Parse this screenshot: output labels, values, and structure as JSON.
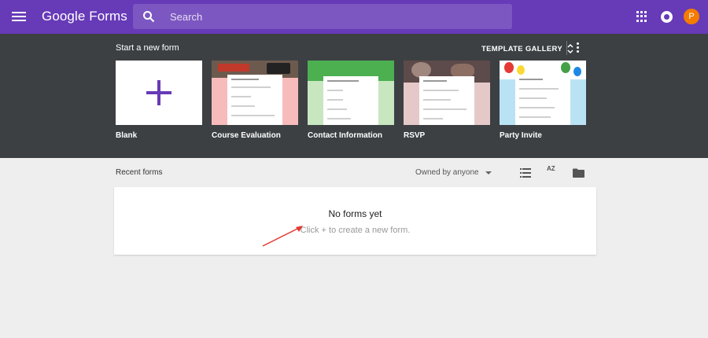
{
  "appbar": {
    "brand": "Google Forms",
    "search_placeholder": "Search",
    "avatar_initial": "P",
    "color": "#673ab7",
    "icons": [
      "menu-icon",
      "search-icon",
      "apps-icon",
      "notifications-icon"
    ]
  },
  "templates": {
    "section_title": "Start a new form",
    "gallery_label": "TEMPLATE GALLERY",
    "items": [
      {
        "label": "Blank",
        "color": "#ffffff"
      },
      {
        "label": "Course Evaluation",
        "color": "#f8bbbc"
      },
      {
        "label": "Contact Information",
        "color": "#c8e6c0"
      },
      {
        "label": "RSVP",
        "color": "#e5c9c9"
      },
      {
        "label": "Party Invite",
        "color": "#b9e3f4"
      }
    ]
  },
  "recent": {
    "section_title": "Recent forms",
    "owner_filter": "Owned by anyone",
    "sort_icon_text": "AZ",
    "empty_title": "No forms yet",
    "empty_subtitle": "Click + to create a new form."
  }
}
